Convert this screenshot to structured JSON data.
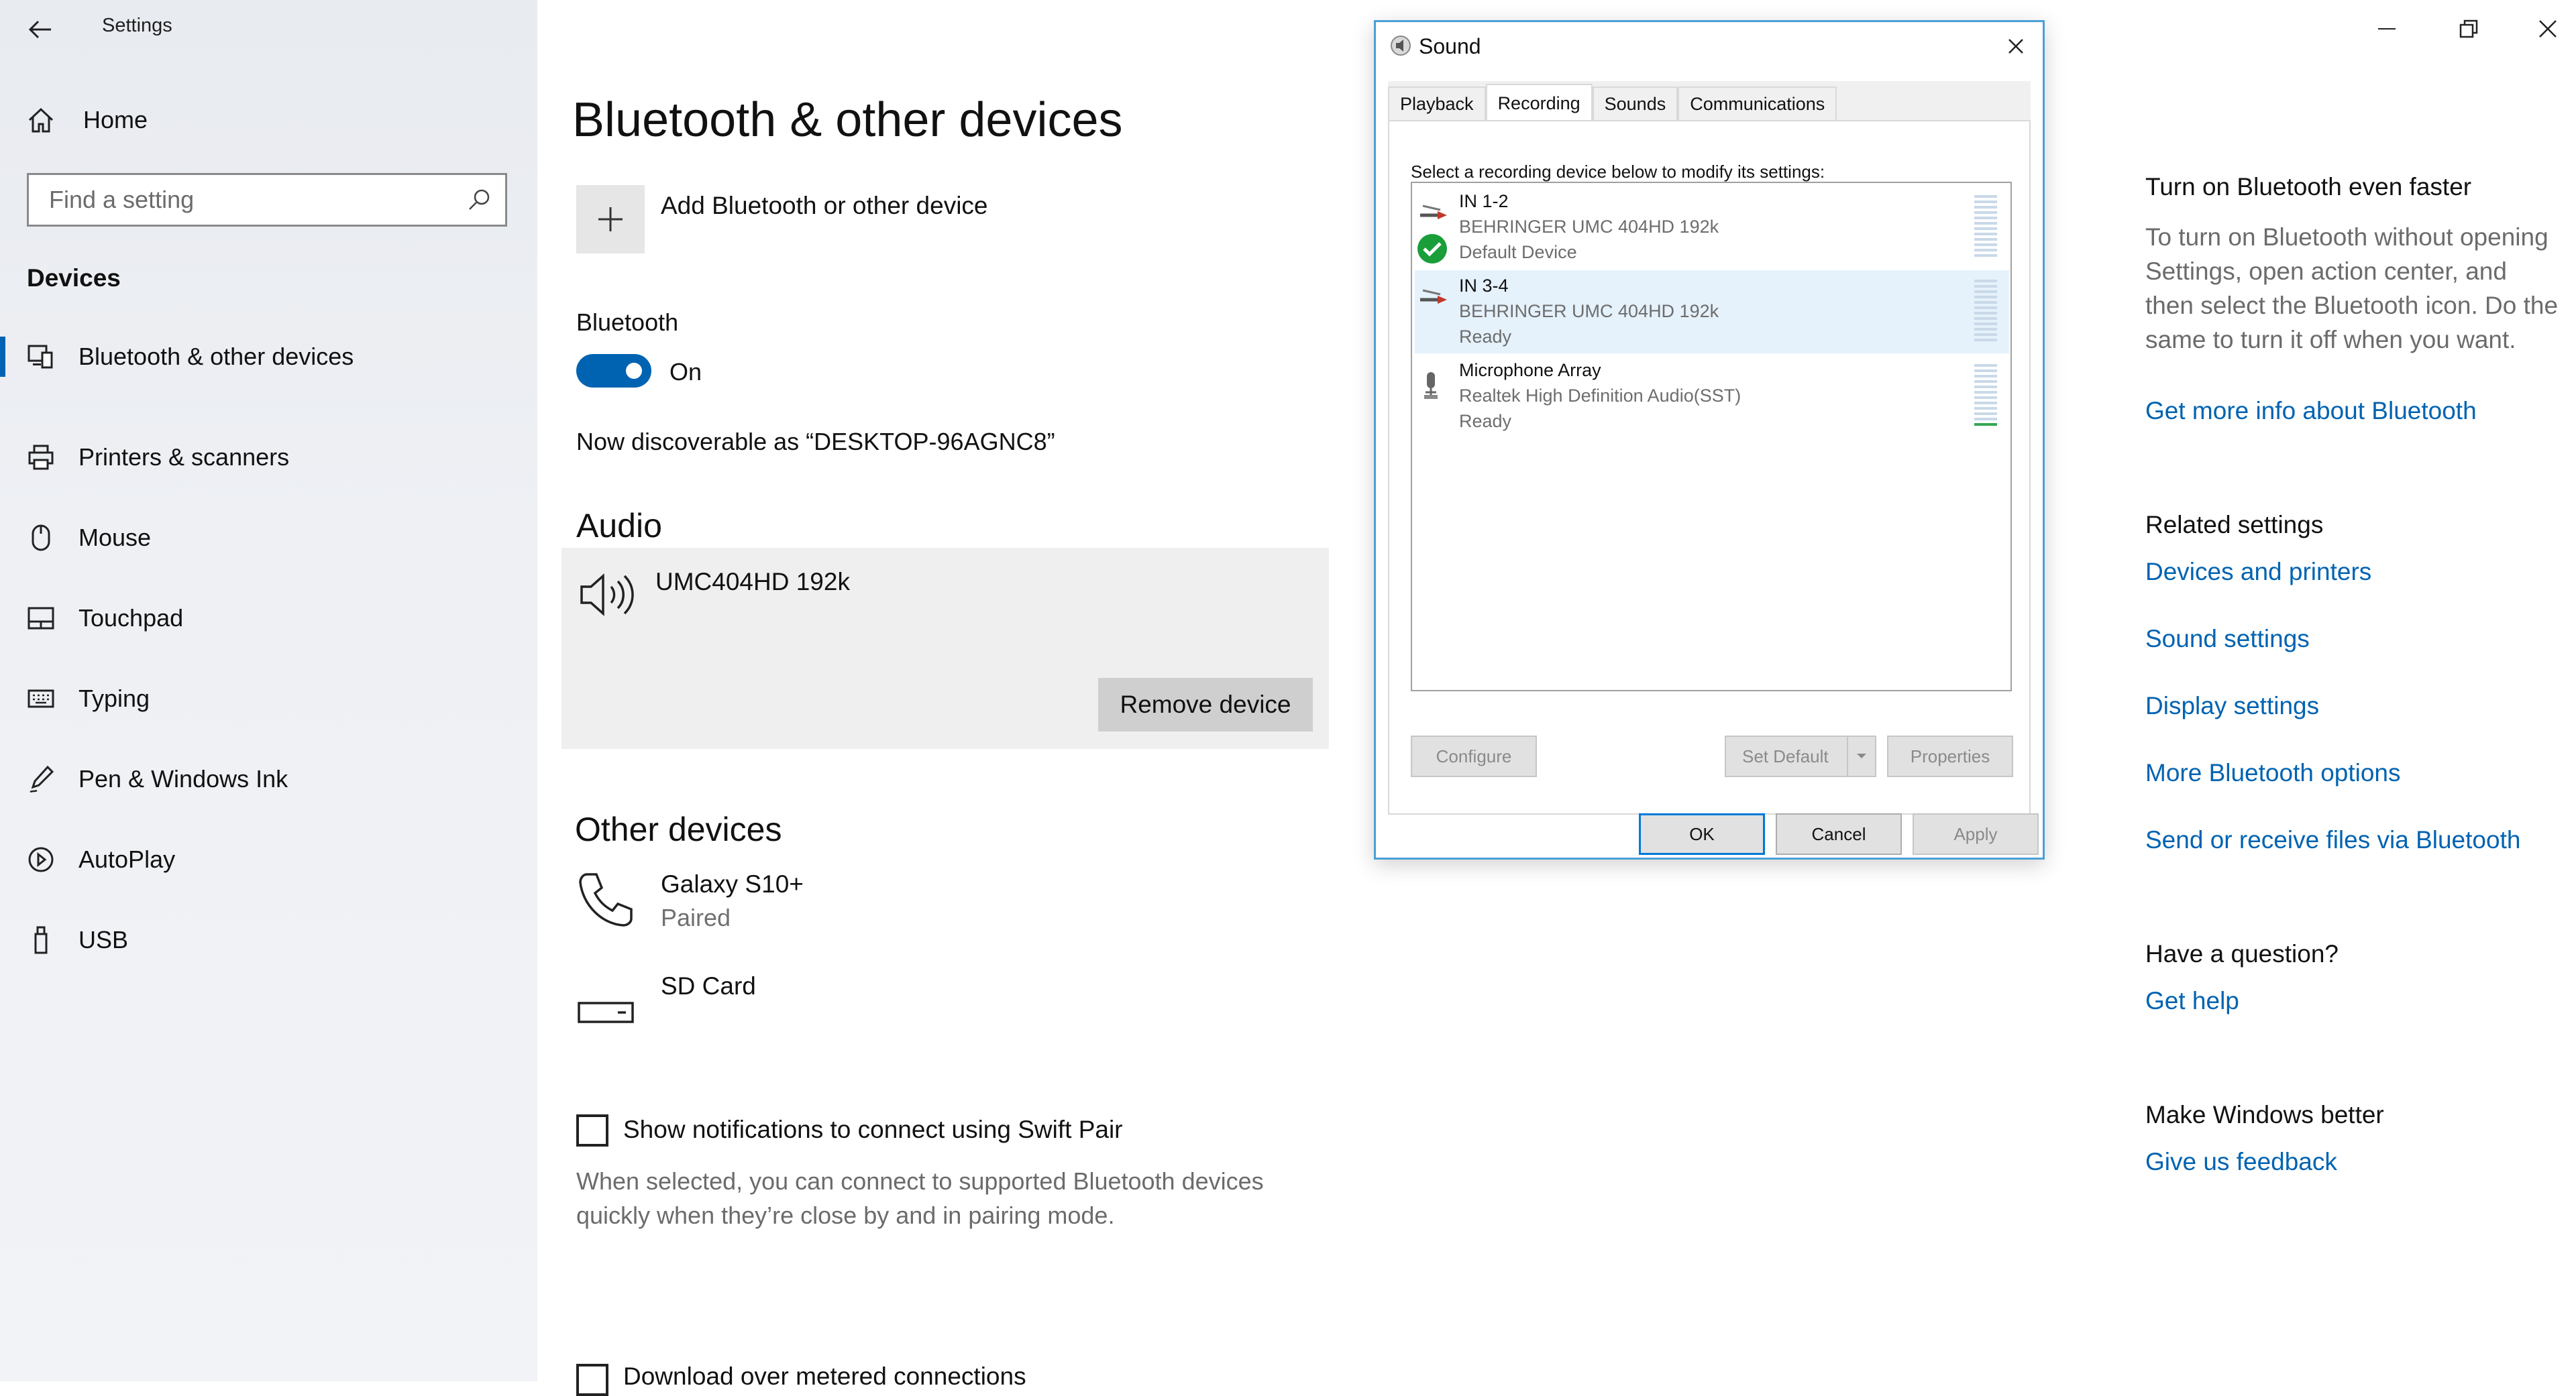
{
  "window": {
    "title": "Settings",
    "controls": [
      "minimize",
      "restore",
      "close"
    ]
  },
  "sidebar": {
    "home_label": "Home",
    "search_placeholder": "Find a setting",
    "section": "Devices",
    "items": [
      {
        "label": "Bluetooth & other devices",
        "icon": "bluetooth-devices-icon",
        "active": true
      },
      {
        "label": "Printers & scanners",
        "icon": "printer-icon"
      },
      {
        "label": "Mouse",
        "icon": "mouse-icon"
      },
      {
        "label": "Touchpad",
        "icon": "touchpad-icon"
      },
      {
        "label": "Typing",
        "icon": "keyboard-icon"
      },
      {
        "label": "Pen & Windows Ink",
        "icon": "pen-icon"
      },
      {
        "label": "AutoPlay",
        "icon": "autoplay-icon"
      },
      {
        "label": "USB",
        "icon": "usb-icon"
      }
    ]
  },
  "main": {
    "title": "Bluetooth & other devices",
    "add_device": "Add Bluetooth or other device",
    "bluetooth_label": "Bluetooth",
    "bluetooth_state": "On",
    "discoverable": "Now discoverable as “DESKTOP-96AGNC8”",
    "audio_heading": "Audio",
    "audio_device": "UMC404HD 192k",
    "remove_button": "Remove device",
    "other_heading": "Other devices",
    "other_devices": [
      {
        "name": "Galaxy S10+",
        "status": "Paired",
        "icon": "phone-icon"
      },
      {
        "name": "SD Card",
        "icon": "sd-card-icon"
      }
    ],
    "swift_pair_label": "Show notifications to connect using Swift Pair",
    "swift_pair_desc": "When selected, you can connect to supported Bluetooth devices quickly when they’re close by and in pairing mode.",
    "metered_label": "Download over metered connections"
  },
  "sound_dialog": {
    "title": "Sound",
    "tabs": [
      "Playback",
      "Recording",
      "Sounds",
      "Communications"
    ],
    "selected_tab": "Recording",
    "instruction": "Select a recording device below to modify its settings:",
    "devices": [
      {
        "name": "IN 1-2",
        "driver": "BEHRINGER UMC 404HD 192k",
        "status": "Default Device",
        "default": true
      },
      {
        "name": "IN 3-4",
        "driver": "BEHRINGER UMC 404HD 192k",
        "status": "Ready",
        "selected": true
      },
      {
        "name": "Microphone Array",
        "driver": "Realtek High Definition Audio(SST)",
        "status": "Ready",
        "level": 0.1
      }
    ],
    "configure": "Configure",
    "set_default": "Set Default",
    "properties": "Properties",
    "ok": "OK",
    "cancel": "Cancel",
    "apply": "Apply"
  },
  "right_pane": {
    "bt_faster_heading": "Turn on Bluetooth even faster",
    "bt_faster_text": "To turn on Bluetooth without opening Settings, open action center, and then select the Bluetooth icon. Do the same to turn it off when you want.",
    "bt_info_link": "Get more info about Bluetooth",
    "related_heading": "Related settings",
    "related_links": [
      "Devices and printers",
      "Sound settings",
      "Display settings",
      "More Bluetooth options",
      "Send or receive files via Bluetooth"
    ],
    "question_heading": "Have a question?",
    "help_link": "Get help",
    "better_heading": "Make Windows better",
    "feedback_link": "Give us feedback"
  },
  "colors": {
    "accent": "#0063b1",
    "dialog_border": "#4a9fd8",
    "selected_row": "#e5f1fb"
  }
}
